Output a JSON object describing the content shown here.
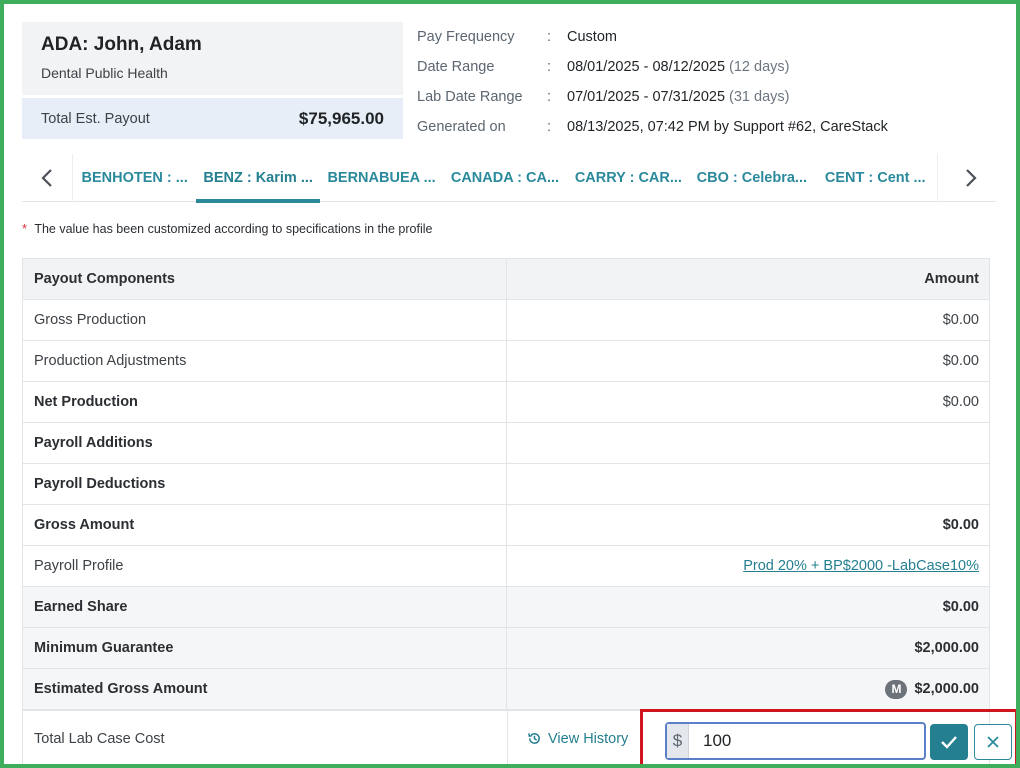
{
  "provider": {
    "name": "ADA: John, Adam",
    "specialty": "Dental Public Health",
    "payout_label": "Total Est. Payout",
    "payout_value": "$75,965.00"
  },
  "meta": [
    {
      "label": "Pay Frequency",
      "value": "Custom",
      "extra": ""
    },
    {
      "label": "Date Range",
      "value": "08/01/2025 - 08/12/2025",
      "extra": "(12 days)"
    },
    {
      "label": "Lab Date Range",
      "value": "07/01/2025 - 07/31/2025",
      "extra": "(31 days)"
    },
    {
      "label": "Generated on",
      "value": "08/13/2025, 07:42 PM by Support #62, CareStack",
      "extra": ""
    }
  ],
  "meta_colon": ":",
  "tabs": [
    {
      "label": "BENHOTEN : ..."
    },
    {
      "label": "BENZ : Karim ..."
    },
    {
      "label": "BERNABUEA ..."
    },
    {
      "label": "CANADA : CA..."
    },
    {
      "label": "CARRY : CAR..."
    },
    {
      "label": "CBO : Celebra..."
    },
    {
      "label": "CENT : Cent ..."
    }
  ],
  "active_tab_index": 1,
  "arrows": {
    "left": "‹",
    "right": "›"
  },
  "note": {
    "star": "*",
    "text": "The value has been customized according to specifications in the profile"
  },
  "table": {
    "header": {
      "component": "Payout Components",
      "amount": "Amount"
    },
    "rows": [
      {
        "label": "Gross Production",
        "amount": "$0.00"
      },
      {
        "label": "Production Adjustments",
        "amount": "$0.00"
      },
      {
        "label": "Net Production",
        "amount": "$0.00"
      },
      {
        "label": "Payroll Additions",
        "amount": ""
      },
      {
        "label": "Payroll Deductions",
        "amount": ""
      },
      {
        "label": "Gross Amount",
        "amount": "$0.00"
      },
      {
        "label": "Payroll Profile",
        "amount": "Prod 20% + BP$2000 -LabCase10%"
      },
      {
        "label": "Earned Share",
        "amount": "$0.00"
      },
      {
        "label": "Minimum Guarantee",
        "amount": "$2,000.00"
      },
      {
        "label": "Estimated Gross Amount",
        "amount": "$2,000.00",
        "badge": "M"
      }
    ],
    "last_row": {
      "label": "Total Lab Case Cost",
      "view_history": "View History",
      "currency": "$",
      "input_value": "100"
    }
  },
  "colors": {
    "accent": "#2a8a9c",
    "highlight_border": "#d0141d",
    "frame": "#3fae5c"
  }
}
